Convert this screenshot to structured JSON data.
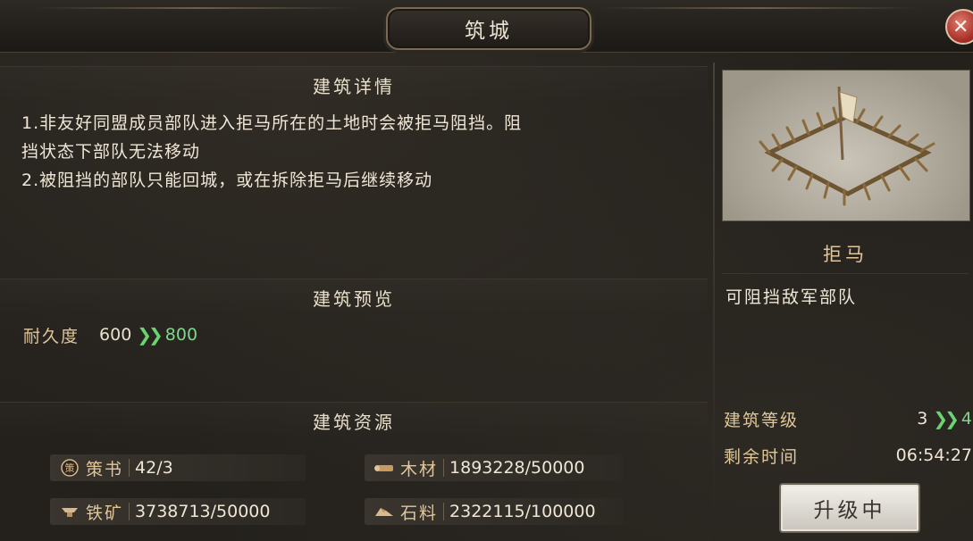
{
  "window": {
    "title": "筑城"
  },
  "details": {
    "heading": "建筑详情",
    "lines": [
      "1.非友好同盟成员部队进入拒马所在的土地时会被拒马阻挡。阻",
      "挡状态下部队无法移动",
      "2.被阻挡的部队只能回城，或在拆除拒马后继续移动"
    ]
  },
  "preview": {
    "heading": "建筑预览",
    "durability_label": "耐久度",
    "durability_current": "600",
    "durability_next": "800"
  },
  "resources": {
    "heading": "建筑资源",
    "items": [
      {
        "icon": "strategy-book-icon",
        "name": "策书",
        "value": "42/3"
      },
      {
        "icon": "wood-icon",
        "name": "木材",
        "value": "1893228/50000"
      },
      {
        "icon": "iron-ore-icon",
        "name": "铁矿",
        "value": "3738713/50000"
      },
      {
        "icon": "stone-icon",
        "name": "石料",
        "value": "2322115/100000"
      }
    ]
  },
  "building": {
    "name": "拒马",
    "description": "可阻挡敌军部队",
    "level_label": "建筑等级",
    "level_current": "3",
    "level_next": "4",
    "time_label": "剩余时间",
    "time_value": "06:54:27",
    "upgrade_button": "升级中"
  },
  "colors": {
    "accent_green": "#6bd36f",
    "label_gold": "#e0c79a",
    "close_red": "#a22a24"
  },
  "icons": {
    "close": "close-icon",
    "arrow": "double-chevron-right-icon"
  }
}
